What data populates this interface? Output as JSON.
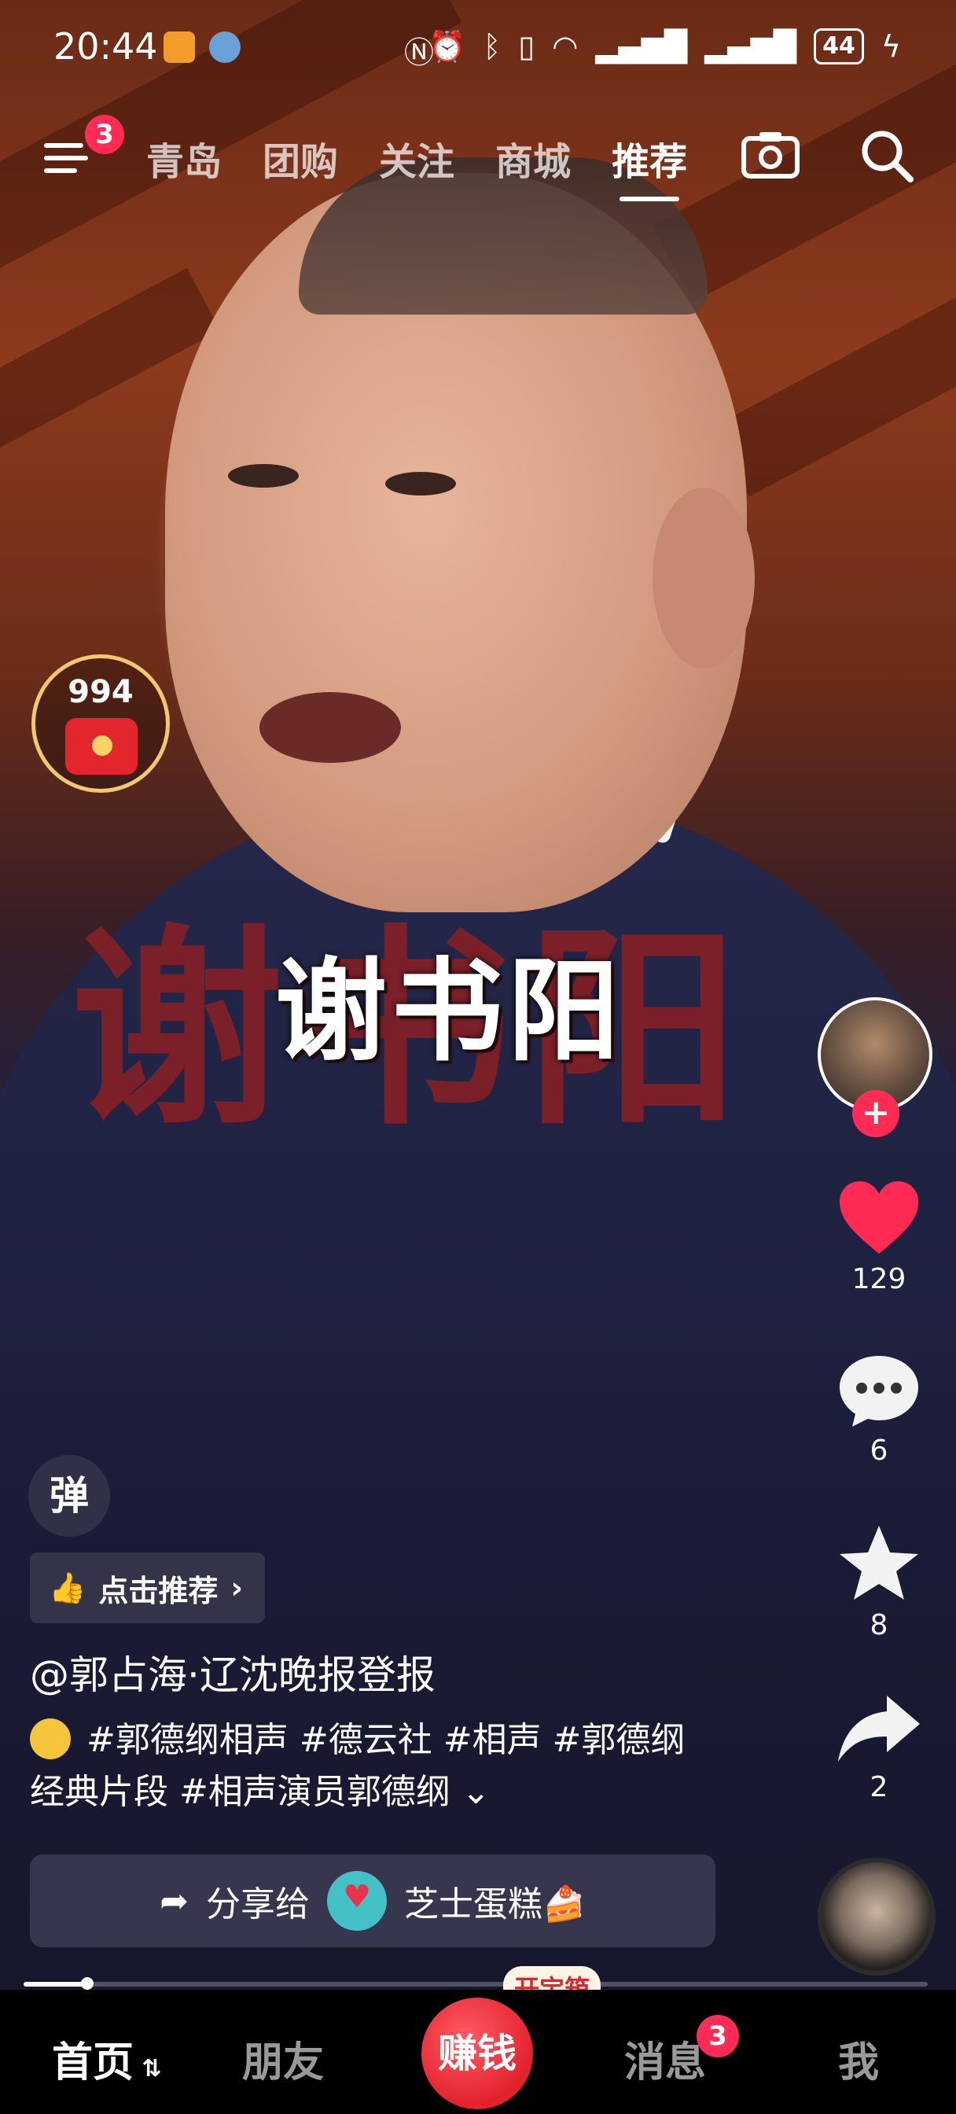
{
  "status_bar": {
    "time": "20:44",
    "battery": "44"
  },
  "top_nav": {
    "menu_badge": "3",
    "tabs": [
      "青岛",
      "团购",
      "关注",
      "商城",
      "推荐"
    ],
    "active_tab": "推荐"
  },
  "video": {
    "caption": "谢书阳",
    "background_text": "谢书阳"
  },
  "red_packet": {
    "count": "994"
  },
  "right_rail": {
    "likes": "129",
    "comments": "6",
    "favorites": "8",
    "shares": "2"
  },
  "info": {
    "danmu_label": "弹",
    "recommend_label": "点击推荐",
    "author": "@郭占海·辽沈晚报登报",
    "description_line1": "#郭德纲相声 #德云社 #相声 #郭德纲",
    "description_line2": "经典片段 #相声演员郭德纲"
  },
  "share_bar": {
    "label": "分享给",
    "friend": "芝士蛋糕🍰"
  },
  "playback_progress": 0.07,
  "bottom_nav": {
    "home": "首页",
    "friends": "朋友",
    "earn": "赚钱",
    "earn_tag": "开宝箱",
    "messages": "消息",
    "messages_badge": "3",
    "me": "我"
  },
  "colors": {
    "accent_red": "#fe2c55",
    "gold_ring": "#f2c873"
  }
}
